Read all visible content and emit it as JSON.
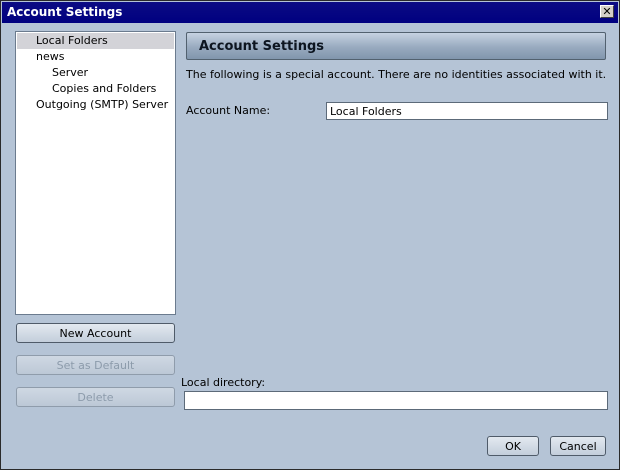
{
  "window": {
    "title": "Account Settings",
    "close_glyph": "✕",
    "close_icon": "close-icon"
  },
  "tree": {
    "items": [
      {
        "label": "Local Folders",
        "selected": true,
        "indent": 0
      },
      {
        "label": "news",
        "selected": false,
        "indent": 0
      },
      {
        "label": "Server",
        "selected": false,
        "indent": 1
      },
      {
        "label": "Copies and Folders",
        "selected": false,
        "indent": 1
      },
      {
        "label": "Outgoing (SMTP) Server",
        "selected": false,
        "indent": 0
      }
    ]
  },
  "buttons": {
    "new_account": "New Account",
    "set_default": "Set as Default",
    "delete": "Delete",
    "ok": "OK",
    "cancel": "Cancel"
  },
  "panel": {
    "header": "Account Settings",
    "info": "The following is a special account. There are no identities associated with it.",
    "account_name_label": "Account Name:",
    "account_name_value": "Local Folders",
    "local_directory_label": "Local directory:",
    "local_directory_value": ""
  },
  "colors": {
    "titlebar": "#000080",
    "background": "#b5c4d6"
  }
}
